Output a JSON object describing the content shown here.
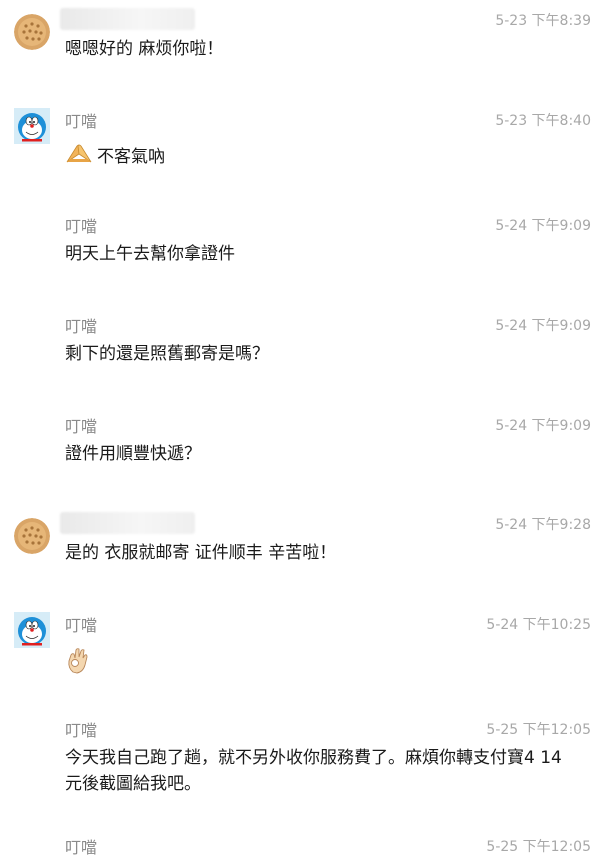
{
  "messages": [
    {
      "sender": "",
      "time": "5-23 下午8:39",
      "text": "嗯嗯好的 麻烦你啦！"
    },
    {
      "sender": "叮噹",
      "time": "5-23 下午8:40",
      "text": "不客氣吶",
      "emoji": "praying-hands-emoji"
    },
    {
      "sender": "叮噹",
      "time": "5-24 下午9:09",
      "text": "明天上午去幫你拿證件"
    },
    {
      "sender": "叮噹",
      "time": "5-24 下午9:09",
      "text": "剩下的還是照舊郵寄是嗎？"
    },
    {
      "sender": "叮噹",
      "time": "5-24 下午9:09",
      "text": "證件用順豐快遞？"
    },
    {
      "sender": "",
      "time": "5-24 下午9:28",
      "text": "是的 衣服就邮寄 证件顺丰 辛苦啦！"
    },
    {
      "sender": "叮噹",
      "time": "5-24 下午10:25",
      "emoji": "ok-hand-emoji"
    },
    {
      "sender": "叮噹",
      "time": "5-25 下午12:05",
      "text": "今天我自己跑了趟，就不另外收你服務費了。麻煩你轉支付寶4 14元後截圖給我吧。"
    },
    {
      "sender": "叮噹",
      "time": "5-25 下午12:05"
    }
  ]
}
